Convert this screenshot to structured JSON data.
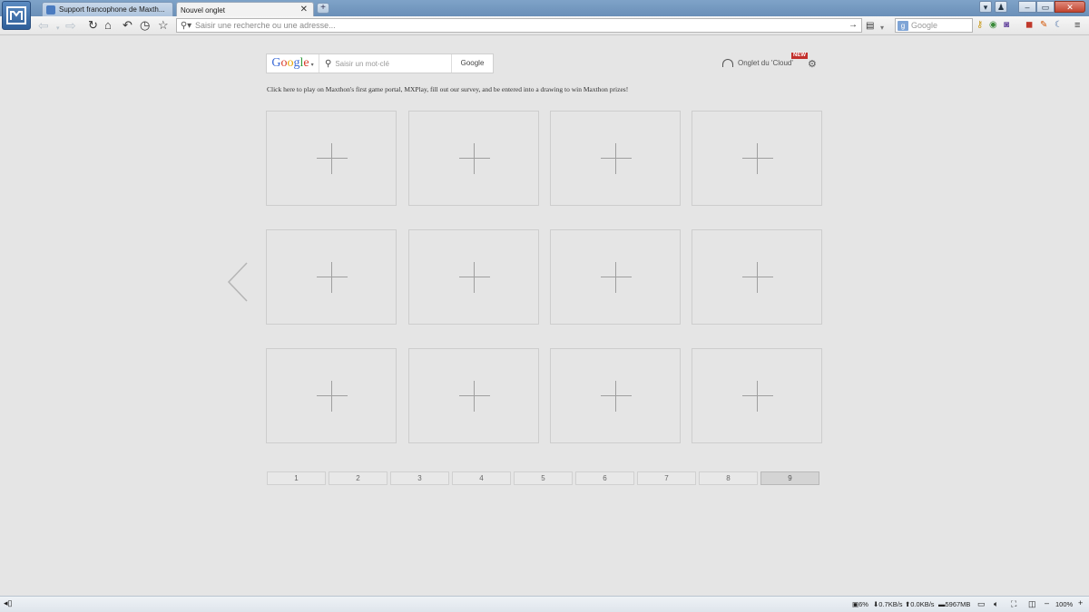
{
  "tabs": [
    {
      "label": "Support francophone de Maxth...",
      "active": false
    },
    {
      "label": "Nouvel onglet",
      "active": true
    }
  ],
  "toolbar": {
    "address_placeholder": "Saisir une recherche ou une adresse...",
    "search_placeholder": "Google"
  },
  "google": {
    "logo": [
      "G",
      "o",
      "o",
      "g",
      "l",
      "e"
    ],
    "placeholder": "Saisir un mot-clé",
    "button": "Google"
  },
  "cloud": {
    "label": "Onglet du 'Cloud'",
    "badge": "NEW"
  },
  "promo_text": "Click here to play on Maxthon's first game portal, MXPlay, fill out our survey, and be entered into a drawing to win Maxthon prizes!",
  "tiles_count": 12,
  "pager": {
    "pages": [
      "1",
      "2",
      "3",
      "4",
      "5",
      "6",
      "7",
      "8",
      "9"
    ],
    "active": "9"
  },
  "status": {
    "cpu": "6%",
    "down": "0.7KB/s",
    "up": "0.0KB/s",
    "mem": "5967MB",
    "zoom": "100%"
  },
  "colors": {
    "background": "#e5e5e5",
    "titlebar": "#6a8fb8",
    "tile_border": "#cdcdcd"
  }
}
